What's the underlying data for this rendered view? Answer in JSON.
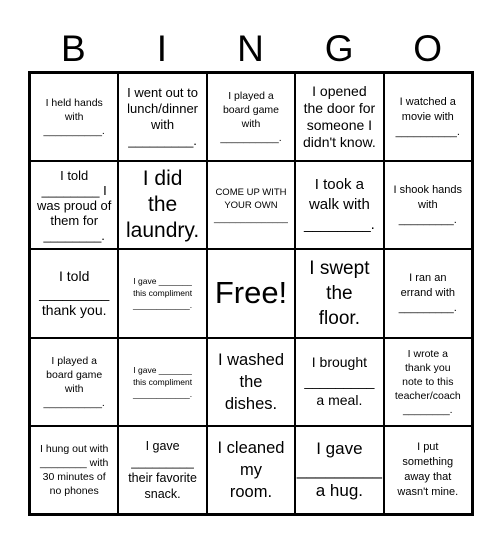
{
  "header": [
    "B",
    "I",
    "N",
    "G",
    "O"
  ],
  "cells": [
    [
      "I held hands\nwith\n__________.",
      "I went out to\nlunch/dinner\nwith\n_________.",
      "I played a\nboard game\nwith\n__________.",
      "I opened\nthe door for\nsomeone I\ndidn't know.",
      "I watched a\nmovie with\n__________."
    ],
    [
      "I told\n________ I\nwas proud of\nthem for\n________.",
      "I did\nthe\nlaundry.",
      "COME UP WITH\nYOUR OWN\n______________",
      "I took a\nwalk with\n________.",
      "I shook hands\nwith\n_________."
    ],
    [
      "I told\n_________\nthank you.",
      "I gave _______\nthis compliment\n____________.",
      "Free!",
      "I swept\nthe\nfloor.",
      "I ran an\nerrand with\n_________."
    ],
    [
      "I played a\nboard game\nwith\n__________.",
      "I gave _______\nthis compliment\n____________.",
      "I washed\nthe\ndishes.",
      "I brought\n_________\na meal.",
      "I wrote a\nthank you\nnote to this\nteacher/coach\n________."
    ],
    [
      "I hung out with\n________ with\n30 minutes of\nno phones",
      "I gave\n_________\ntheir favorite\nsnack.",
      "I cleaned\nmy\nroom.",
      "I gave\n_________\na hug.",
      "I put\nsomething\naway that\nwasn't mine."
    ]
  ]
}
